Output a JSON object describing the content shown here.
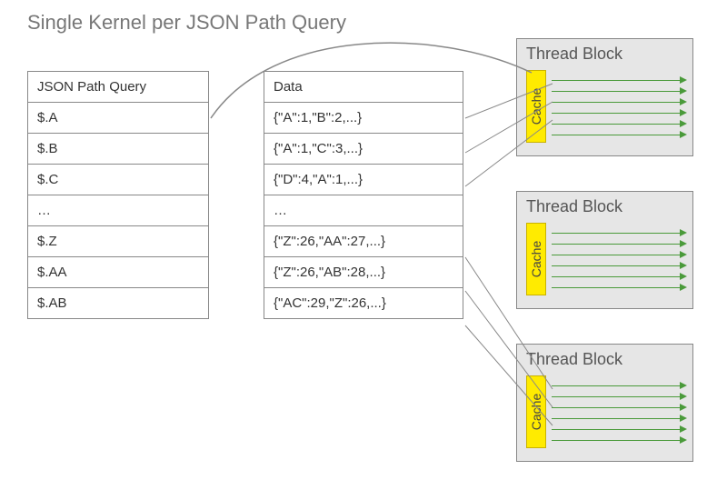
{
  "title": "Single Kernel per JSON Path Query",
  "query_table": {
    "header": "JSON Path Query",
    "rows": [
      "$.A",
      "$.B",
      "$.C",
      "…",
      "$.Z",
      "$.AA",
      "$.AB"
    ]
  },
  "data_table": {
    "header": "Data",
    "rows": [
      "{\"A\":1,\"B\":2,...}",
      "{\"A\":1,\"C\":3,...}",
      "{\"D\":4,\"A\":1,...}",
      "…",
      "{\"Z\":26,\"AA\":27,...}",
      "{\"Z\":26,\"AB\":28,...}",
      "{\"AC\":29,\"Z\":26,...}"
    ]
  },
  "thread_block": {
    "title": "Thread Block",
    "cache_label": "Cache",
    "thread_count": 6,
    "count": 3
  },
  "colors": {
    "title_gray": "#777777",
    "block_bg": "#e6e6e6",
    "cache_bg": "#ffeb00",
    "thread_green": "#4a9a3a",
    "connector_gray": "#888888"
  },
  "chart_data": {
    "type": "diagram",
    "title": "Single Kernel per JSON Path Query",
    "query_paths": [
      "$.A",
      "$.B",
      "$.C",
      "…",
      "$.Z",
      "$.AA",
      "$.AB"
    ],
    "data_rows": [
      "{\"A\":1,\"B\":2,...}",
      "{\"A\":1,\"C\":3,...}",
      "{\"D\":4,\"A\":1,...}",
      "…",
      "{\"Z\":26,\"AA\":27,...}",
      "{\"Z\":26,\"AB\":28,...}",
      "{\"AC\":29,\"Z\":26,...}"
    ],
    "thread_blocks": 3,
    "threads_per_block": 6,
    "connectors": [
      {
        "from": "query_row_0",
        "to": "thread_block_0_cache",
        "via": "curve_over_data"
      },
      {
        "from": "data_row_0",
        "to": "thread_block_0_thread_area"
      },
      {
        "from": "data_row_1",
        "to": "thread_block_0_thread_area"
      },
      {
        "from": "data_row_2",
        "to": "thread_block_0_thread_area"
      },
      {
        "from": "data_row_4",
        "to": "thread_block_2_thread_area"
      },
      {
        "from": "data_row_5",
        "to": "thread_block_2_thread_area"
      },
      {
        "from": "data_row_6",
        "to": "thread_block_2_thread_area"
      }
    ]
  }
}
